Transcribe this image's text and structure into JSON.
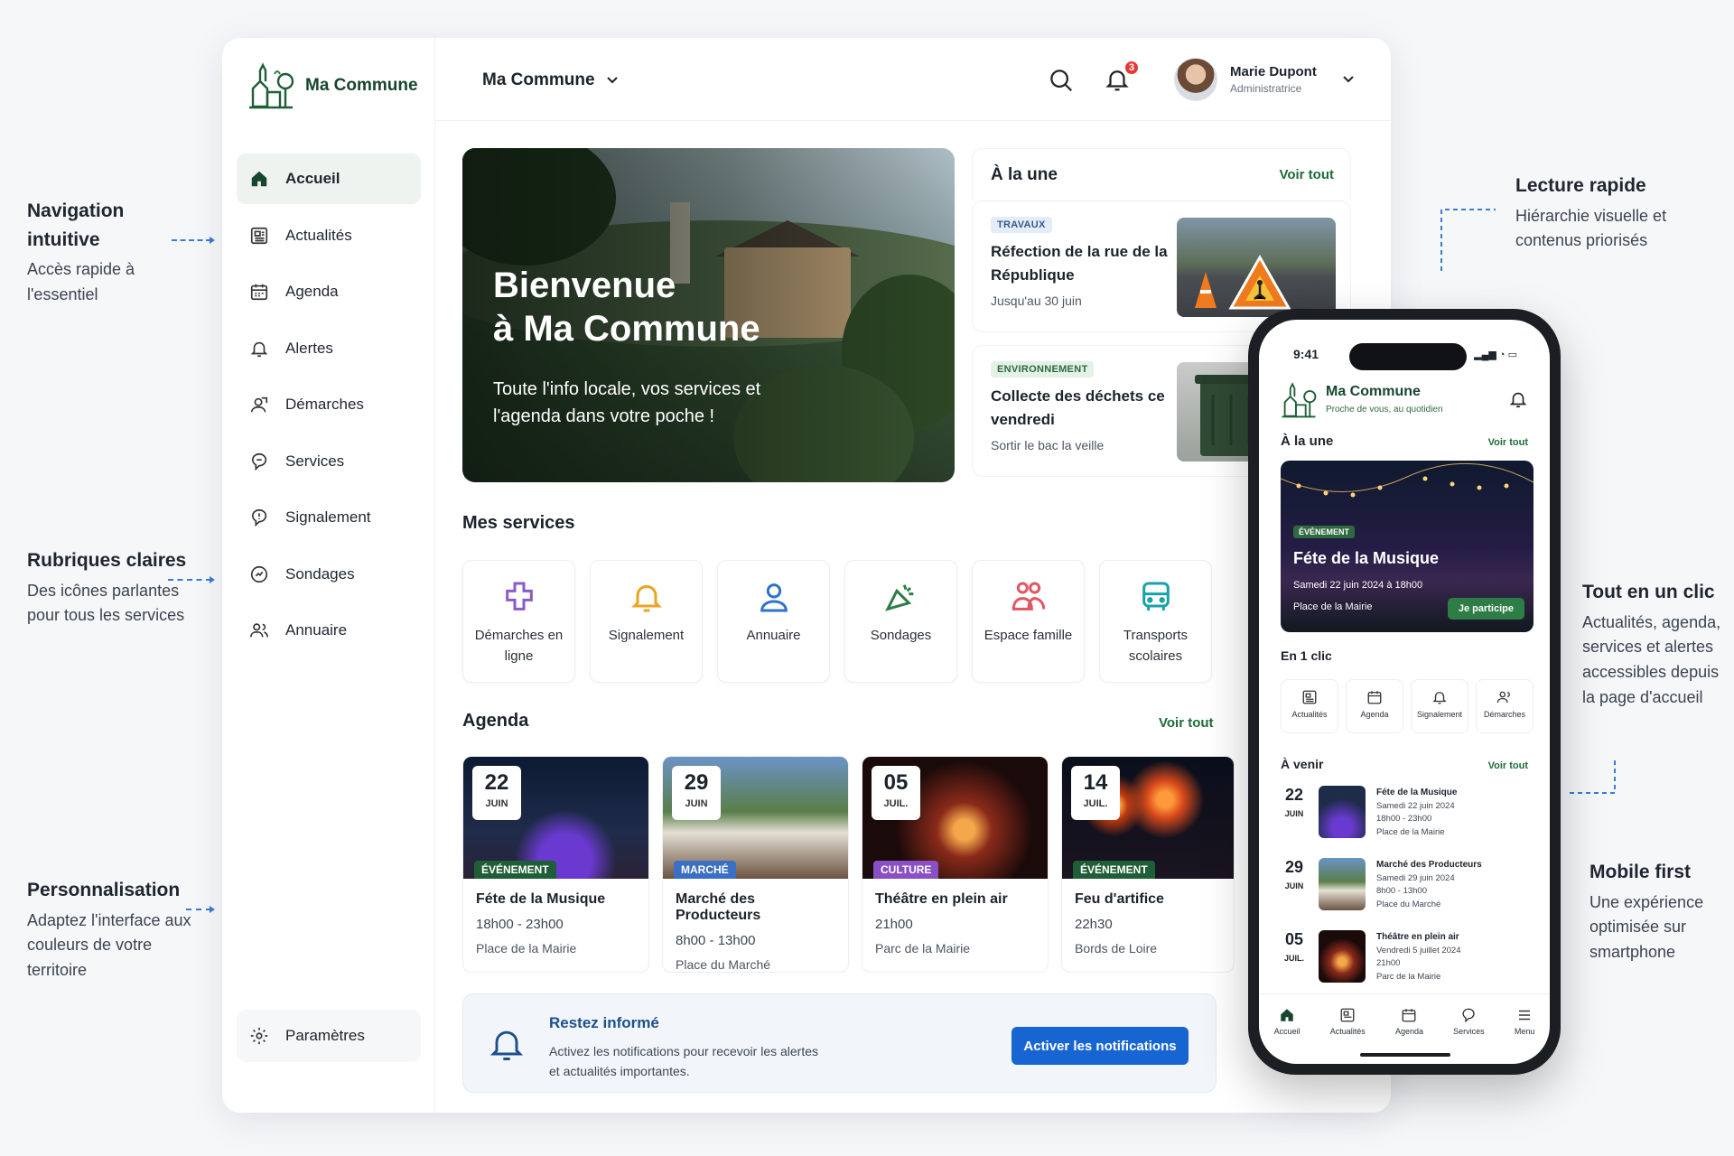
{
  "annotations": {
    "left": [
      {
        "title": "Navigation intuitive",
        "text": "Accès rapide à l'essentiel"
      },
      {
        "title": "Rubriques claires",
        "text": "Des icônes parlantes pour tous les services"
      },
      {
        "title": "Personnalisation",
        "text": "Adaptez l'interface aux couleurs de votre territoire"
      }
    ],
    "right": [
      {
        "title": "Lecture rapide",
        "text": "Hiérarchie visuelle et contenus priorisés"
      },
      {
        "title": "Tout en un clic",
        "text": "Actualités, agenda, services et alertes accessibles depuis la page d'accueil"
      },
      {
        "title": "Mobile first",
        "text": "Une expérience optimisée sur smartphone"
      }
    ]
  },
  "brand": {
    "name": "Ma Commune"
  },
  "sidebar": {
    "items": [
      {
        "label": "Accueil",
        "icon": "home-icon"
      },
      {
        "label": "Actualités",
        "icon": "newspaper-icon"
      },
      {
        "label": "Agenda",
        "icon": "calendar-icon"
      },
      {
        "label": "Alertes",
        "icon": "bell-icon"
      },
      {
        "label": "Démarches",
        "icon": "person-doc-icon"
      },
      {
        "label": "Services",
        "icon": "speech-icon"
      },
      {
        "label": "Signalement",
        "icon": "report-icon"
      },
      {
        "label": "Sondages",
        "icon": "poll-icon"
      },
      {
        "label": "Annuaire",
        "icon": "people-icon"
      }
    ],
    "settings": "Paramètres"
  },
  "topbar": {
    "commune_select": "Ma Commune",
    "notif_count": "3",
    "user_name": "Marie Dupont",
    "user_role": "Administratrice"
  },
  "hero": {
    "title_line1": "Bienvenue",
    "title_line2": "à Ma Commune",
    "subtitle": "Toute l'info locale, vos services et l'agenda dans votre poche !"
  },
  "une": {
    "title": "À la une",
    "see_all": "Voir tout",
    "items": [
      {
        "tag": "TRAVAUX",
        "title": "Réfection de la rue de la République",
        "sub": "Jusqu'au 30 juin"
      },
      {
        "tag": "ENVIRONNEMENT",
        "title": "Collecte des déchets ce vendredi",
        "sub": "Sortir le bac la veille"
      }
    ]
  },
  "services": {
    "title": "Mes services",
    "items": [
      {
        "label": "Démarches en ligne",
        "icon": "puzzle-icon",
        "color": "#8b5cc6"
      },
      {
        "label": "Signalement",
        "icon": "bell-icon",
        "color": "#e8a425"
      },
      {
        "label": "Annuaire",
        "icon": "person-icon",
        "color": "#2f73c9"
      },
      {
        "label": "Sondages",
        "icon": "megaphone-icon",
        "color": "#2e7d46"
      },
      {
        "label": "Espace famille",
        "icon": "family-icon",
        "color": "#e25563"
      },
      {
        "label": "Transports scolaires",
        "icon": "bus-icon",
        "color": "#17a2a8"
      }
    ]
  },
  "agenda": {
    "title": "Agenda",
    "see_all": "Voir tout",
    "items": [
      {
        "day": "22",
        "month": "JUIN",
        "cat": "ÉVÉNEMENT",
        "cat_color": "#1f5e36",
        "title": "Féte de la Musique",
        "time": "18h00 - 23h00",
        "place": "Place de la Mairie"
      },
      {
        "day": "29",
        "month": "JUIN",
        "cat": "MARCHÉ",
        "cat_color": "#3a6fc4",
        "title": "Marché des Producteurs",
        "time": "8h00 - 13h00",
        "place": "Place du Marché"
      },
      {
        "day": "05",
        "month": "JUIL.",
        "cat": "CULTURE",
        "cat_color": "#8a4fc2",
        "title": "Théâtre en plein air",
        "time": "21h00",
        "place": "Parc de la Mairie"
      },
      {
        "day": "14",
        "month": "JUIL.",
        "cat": "ÉVÉNEMENT",
        "cat_color": "#1f5e36",
        "title": "Feu d'artifice",
        "time": "22h30",
        "place": "Bords de Loire"
      }
    ]
  },
  "notif": {
    "title": "Restez informé",
    "text": "Activez les notifications pour recevoir les alertes et actualités importantes.",
    "button": "Activer les notifications"
  },
  "phone": {
    "time": "9:41",
    "brand": "Ma Commune",
    "tagline": "Proche de vous, au quotidien",
    "une": "À la une",
    "see_all": "Voir tout",
    "hero_tag": "ÉVÉNEMENT",
    "hero_title": "Féte de la Musique",
    "hero_date": "Samedi 22 juin 2024 à 18h00",
    "hero_place": "Place de la Mairie",
    "hero_btn": "Je participe",
    "one_click": "En 1 clic",
    "tiles": [
      "Actualités",
      "Agenda",
      "Signalement",
      "Démarches"
    ],
    "upcoming": "À venir",
    "events": [
      {
        "day": "22",
        "month": "JUIN",
        "title": "Féte de la Musique",
        "l1": "Samedi 22 juin 2024",
        "l2": "18h00 - 23h00",
        "l3": "Place de la Mairie"
      },
      {
        "day": "29",
        "month": "JUIN",
        "title": "Marché des Producteurs",
        "l1": "Samedi 29 juin 2024",
        "l2": "8h00 - 13h00",
        "l3": "Place du Marché"
      },
      {
        "day": "05",
        "month": "JUIL.",
        "title": "Théâtre en plein air",
        "l1": "Vendredi 5 juillet 2024",
        "l2": "21h00",
        "l3": "Parc de la Mairie"
      }
    ],
    "tabs": [
      "Accueil",
      "Actualités",
      "Agenda",
      "Services",
      "Menu"
    ]
  }
}
